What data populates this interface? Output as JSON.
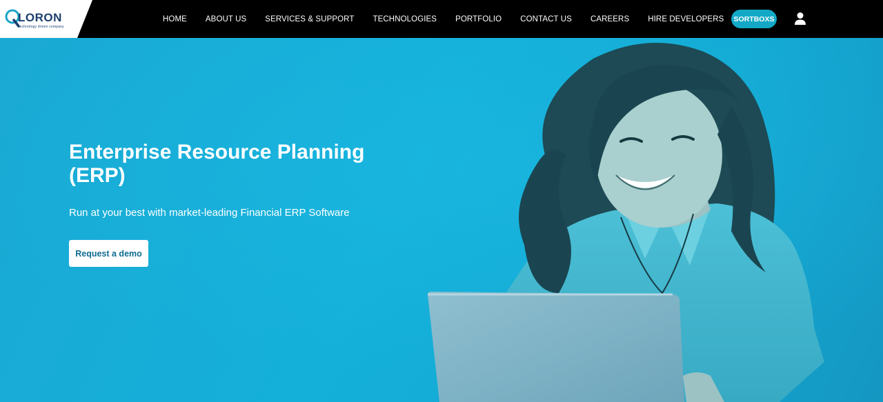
{
  "brand": {
    "logo_text": "LORON",
    "tagline": "technology driven company",
    "colors": {
      "nav_bg": "#000000",
      "hero_bg": "#16a6cf",
      "accent": "#13a9c6",
      "button_text": "#0f6c92"
    }
  },
  "nav": {
    "items": [
      {
        "label": "HOME"
      },
      {
        "label": "ABOUT US"
      },
      {
        "label": "SERVICES & SUPPORT"
      },
      {
        "label": "TECHNOLOGIES"
      },
      {
        "label": "PORTFOLIO"
      },
      {
        "label": "CONTACT US"
      },
      {
        "label": "CAREERS"
      },
      {
        "label": "HIRE DEVELOPERS"
      }
    ],
    "sortbox_label": "SORTBOXS",
    "user_icon": "user-icon"
  },
  "hero": {
    "title": "Enterprise Resource Planning (ERP)",
    "subtitle": "Run at your best with market-leading Financial ERP Software",
    "cta_label": "Request a demo",
    "image": "smiling-woman-with-laptop"
  }
}
